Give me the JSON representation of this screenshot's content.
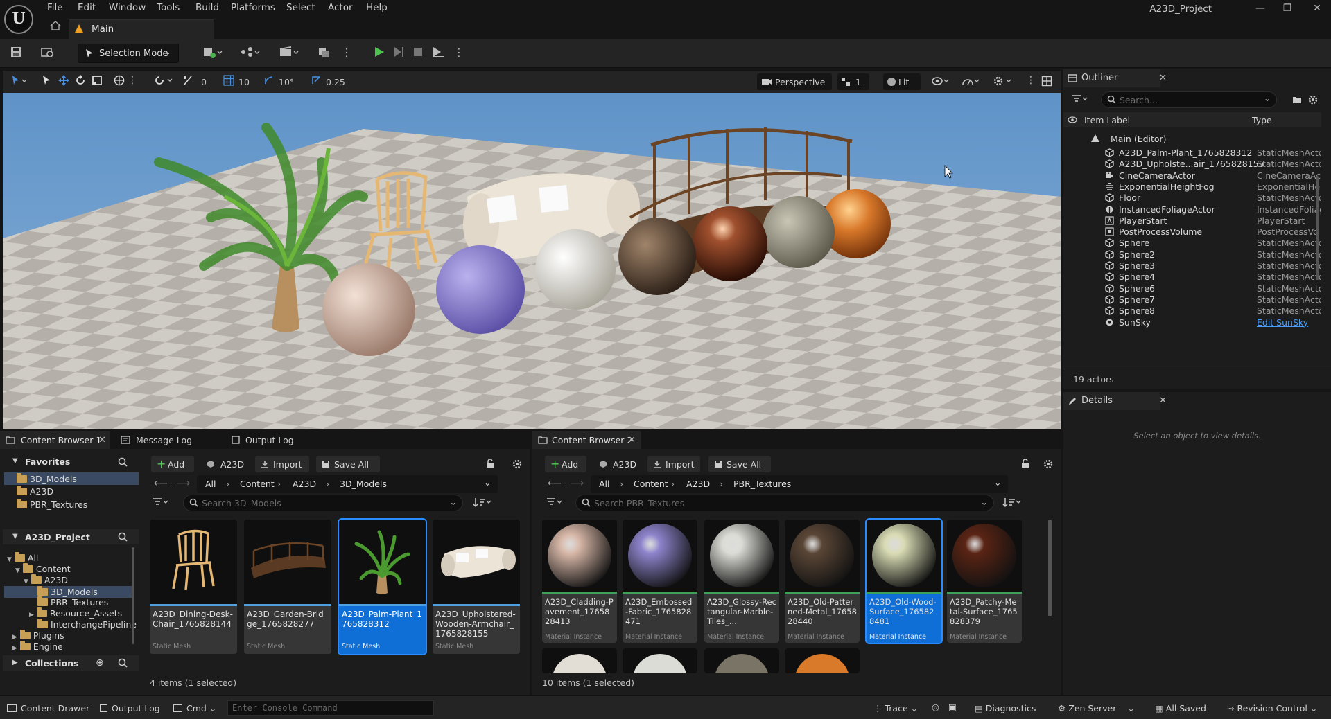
{
  "app": {
    "project_name": "A23D_Project",
    "menu": [
      "File",
      "Edit",
      "Window",
      "Tools",
      "Build",
      "Platforms",
      "Select",
      "Actor",
      "Help"
    ],
    "map_tab": "Main"
  },
  "toolbar": {
    "selection_mode": "Selection Mode"
  },
  "viewport_toolbar": {
    "rotation_snap_count": "0",
    "grid_snap": "10",
    "rotation_snap": "10°",
    "scale_snap": "0.25",
    "view_mode": "Perspective",
    "camera_speed": "1",
    "lighting": "Lit"
  },
  "outliner": {
    "tab_label": "Outliner",
    "search_placeholder": "Search...",
    "col_label": "Item Label",
    "col_type": "Type",
    "root": "Main (Editor)",
    "rows": [
      {
        "name": "A23D_Palm-Plant_1765828312",
        "type": "StaticMeshActo",
        "icon": "static-mesh-icon"
      },
      {
        "name": "A23D_Upholste...air_1765828155",
        "type": "StaticMeshActo",
        "icon": "static-mesh-icon"
      },
      {
        "name": "CineCameraActor",
        "type": "CineCameraAct",
        "icon": "camera-icon"
      },
      {
        "name": "ExponentialHeightFog",
        "type": "ExponentialHeig",
        "icon": "fog-icon"
      },
      {
        "name": "Floor",
        "type": "StaticMeshActo",
        "icon": "static-mesh-icon"
      },
      {
        "name": "InstancedFoliageActor",
        "type": "InstancedFoliag",
        "icon": "foliage-icon"
      },
      {
        "name": "PlayerStart",
        "type": "PlayerStart",
        "icon": "player-start-icon"
      },
      {
        "name": "PostProcessVolume",
        "type": "PostProcessVo",
        "icon": "volume-icon"
      },
      {
        "name": "Sphere",
        "type": "StaticMeshActo",
        "icon": "static-mesh-icon"
      },
      {
        "name": "Sphere2",
        "type": "StaticMeshActo",
        "icon": "static-mesh-icon"
      },
      {
        "name": "Sphere3",
        "type": "StaticMeshActo",
        "icon": "static-mesh-icon"
      },
      {
        "name": "Sphere4",
        "type": "StaticMeshActo",
        "icon": "static-mesh-icon"
      },
      {
        "name": "Sphere6",
        "type": "StaticMeshActo",
        "icon": "static-mesh-icon"
      },
      {
        "name": "Sphere7",
        "type": "StaticMeshActo",
        "icon": "static-mesh-icon"
      },
      {
        "name": "Sphere8",
        "type": "StaticMeshActo",
        "icon": "static-mesh-icon"
      },
      {
        "name": "SunSky",
        "type": "Edit SunSky",
        "icon": "sunsky-icon"
      }
    ],
    "actor_count": "19 actors"
  },
  "details": {
    "tab_label": "Details",
    "empty_message": "Select an object to view details."
  },
  "bottom_tabs": {
    "content_browser_1": "Content Browser 1",
    "message_log": "Message Log",
    "output_log": "Output Log",
    "content_browser_2": "Content Browser 2"
  },
  "content_browser_1": {
    "add": "Add",
    "project_btn": "A23D",
    "import": "Import",
    "save_all": "Save All",
    "breadcrumb": [
      "All",
      "Content",
      "A23D",
      "3D_Models"
    ],
    "search_placeholder": "Search 3D_Models",
    "favorites_label": "Favorites",
    "favorites": [
      "3D_Models",
      "A23D",
      "PBR_Textures"
    ],
    "project_label": "A23D_Project",
    "tree": [
      "All",
      "Content",
      "A23D",
      "3D_Models",
      "PBR_Textures",
      "Resource_Assets",
      "InterchangePipeline",
      "Plugins",
      "Engine"
    ],
    "collections_label": "Collections",
    "assets": [
      {
        "name": "A23D_Dining-Desk-Chair_1765828144",
        "kind": "Static Mesh",
        "selected": false
      },
      {
        "name": "A23D_Garden-Bridge_1765828277",
        "kind": "Static Mesh",
        "selected": false
      },
      {
        "name": "A23D_Palm-Plant_1765828312",
        "kind": "Static Mesh",
        "selected": true
      },
      {
        "name": "A23D_Upholstered-Wooden-Armchair_1765828155",
        "kind": "Static Mesh",
        "selected": false
      }
    ],
    "status": "4 items (1 selected)"
  },
  "content_browser_2": {
    "add": "Add",
    "project_btn": "A23D",
    "import": "Import",
    "save_all": "Save All",
    "breadcrumb": [
      "All",
      "Content",
      "A23D",
      "PBR_Textures"
    ],
    "search_placeholder": "Search PBR_Textures",
    "assets": [
      {
        "name": "A23D_Cladding-Pavement_1765828413",
        "kind": "Material Instance",
        "selected": false,
        "color": "#d8b8a8"
      },
      {
        "name": "A23D_Embossed-Fabric_1765828471",
        "kind": "Material Instance",
        "selected": false,
        "color": "#8d84cc"
      },
      {
        "name": "A23D_Glossy-Rectangular-Marble-Tiles_...",
        "kind": "Material Instance",
        "selected": false,
        "color": "#dcdcd6"
      },
      {
        "name": "A23D_Old-Patterned-Metal_1765828440",
        "kind": "Material Instance",
        "selected": false,
        "color": "#5a4636"
      },
      {
        "name": "A23D_Old-Wood-Surface_1765828481",
        "kind": "Material Instance",
        "selected": true,
        "color": "#d9dcb4"
      },
      {
        "name": "A23D_Patchy-Metal-Surface_1765828379",
        "kind": "Material Instance",
        "selected": false,
        "color": "#5a2414"
      }
    ],
    "status": "10 items (1 selected)"
  },
  "statusbar": {
    "content_drawer": "Content Drawer",
    "output_log": "Output Log",
    "cmd": "Cmd",
    "console_placeholder": "Enter Console Command",
    "trace": "Trace",
    "diagnostics": "Diagnostics",
    "zen_server": "Zen Server",
    "all_saved": "All Saved",
    "revision_control": "Revision Control"
  }
}
